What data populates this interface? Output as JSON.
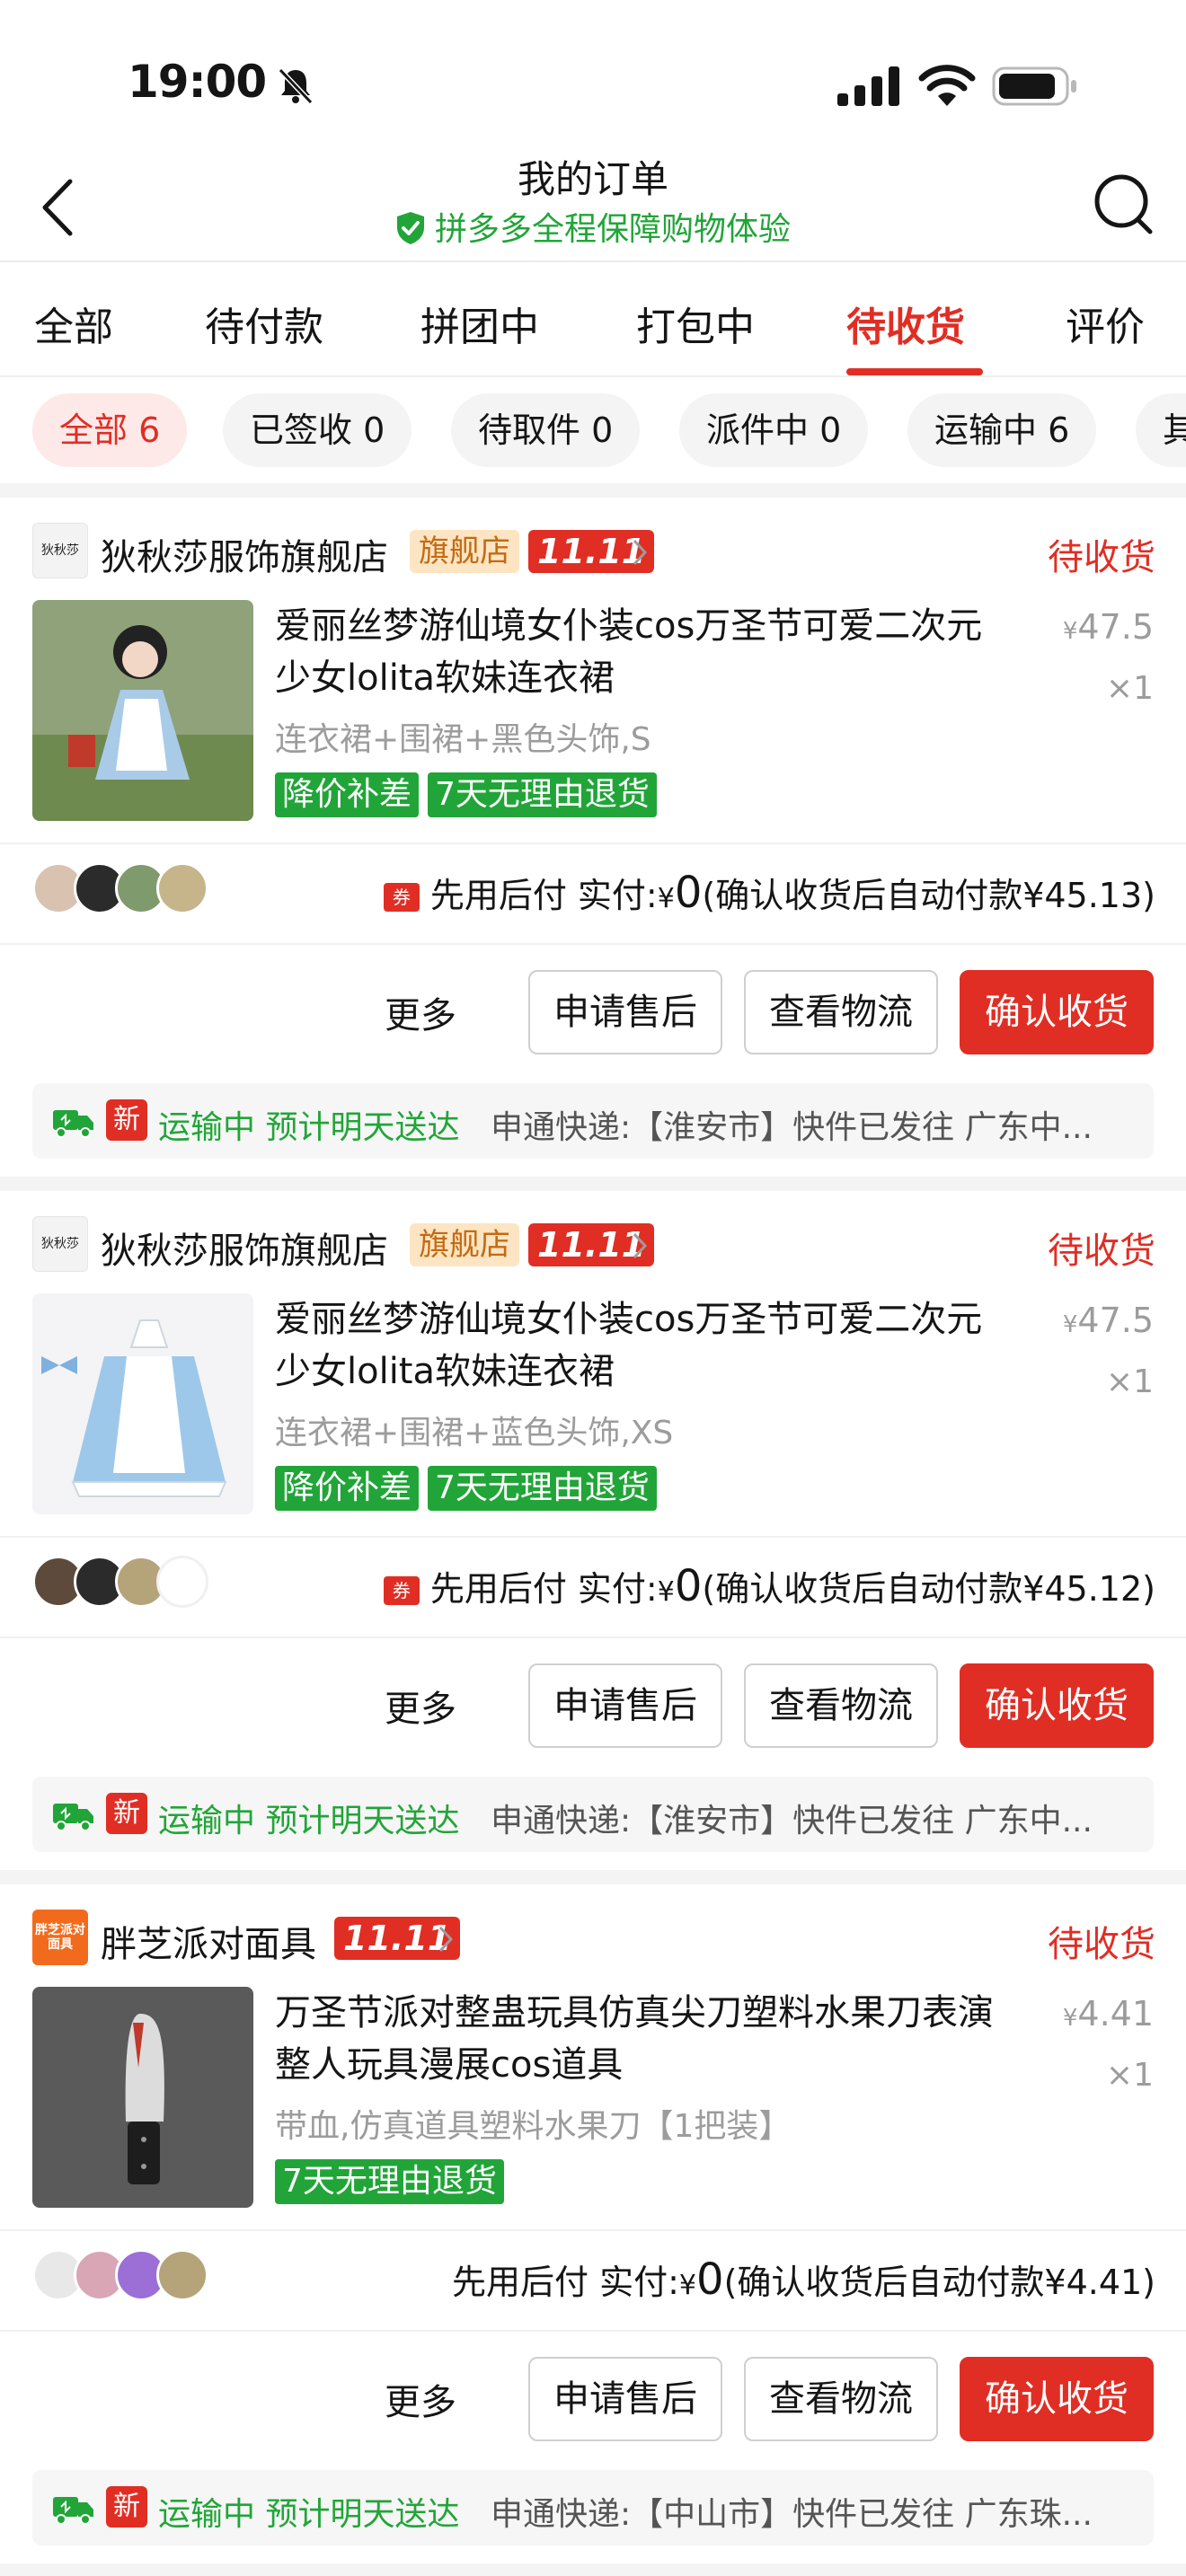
{
  "status_bar": {
    "time": "19:00"
  },
  "header": {
    "title": "我的订单",
    "subtitle": "拼多多全程保障购物体验"
  },
  "tabs": [
    {
      "label": "全部",
      "active": false
    },
    {
      "label": "待付款",
      "active": false
    },
    {
      "label": "拼团中",
      "active": false
    },
    {
      "label": "打包中",
      "active": false
    },
    {
      "label": "待收货",
      "active": true
    },
    {
      "label": "评价",
      "active": false
    }
  ],
  "filters": [
    {
      "label": "全部 6",
      "active": true
    },
    {
      "label": "已签收 0",
      "active": false
    },
    {
      "label": "待取件 0",
      "active": false
    },
    {
      "label": "派件中 0",
      "active": false
    },
    {
      "label": "运输中 6",
      "active": false
    },
    {
      "label": "其",
      "active": false
    }
  ],
  "colors": {
    "accent": "#e02e24",
    "green": "#21a538",
    "gray_text": "#9c9c9c"
  },
  "orders": [
    {
      "shop_logo_text": "狄秋莎",
      "shop_name": "狄秋莎服饰旗舰店",
      "flagship_badge": "旗舰店",
      "event_badge": "11.11",
      "status": "待收货",
      "title": "爱丽丝梦游仙境女仆装cos万圣节可爱二次元少女lolita软妹连衣裙",
      "spec": "连衣裙+围裙+黑色头饰,S",
      "tags": [
        "降价补差",
        "7天无理由退货"
      ],
      "price": "47.5",
      "qty": "×1",
      "pay_prefix": "先用后付 实付:",
      "pay_amount": "0",
      "pay_suffix": "(确认收货后自动付款¥45.13)",
      "coupon_icon": "券",
      "actions": {
        "more": "更多",
        "after_sale": "申请售后",
        "logistics": "查看物流",
        "confirm": "确认收货"
      },
      "log_new": "新",
      "log_status": "运输中 预计明天送达",
      "log_detail": "申通快递:【淮安市】快件已发往 广东中..."
    },
    {
      "shop_logo_text": "狄秋莎",
      "shop_name": "狄秋莎服饰旗舰店",
      "flagship_badge": "旗舰店",
      "event_badge": "11.11",
      "status": "待收货",
      "title": "爱丽丝梦游仙境女仆装cos万圣节可爱二次元少女lolita软妹连衣裙",
      "spec": "连衣裙+围裙+蓝色头饰,XS",
      "tags": [
        "降价补差",
        "7天无理由退货"
      ],
      "price": "47.5",
      "qty": "×1",
      "pay_prefix": "先用后付 实付:",
      "pay_amount": "0",
      "pay_suffix": "(确认收货后自动付款¥45.12)",
      "coupon_icon": "券",
      "actions": {
        "more": "更多",
        "after_sale": "申请售后",
        "logistics": "查看物流",
        "confirm": "确认收货"
      },
      "log_new": "新",
      "log_status": "运输中 预计明天送达",
      "log_detail": "申通快递:【淮安市】快件已发往 广东中..."
    },
    {
      "shop_logo_text": "胖芝派对面具",
      "shop_name": "胖芝派对面具",
      "flagship_badge": "",
      "event_badge": "11.11",
      "status": "待收货",
      "title": "万圣节派对整蛊玩具仿真尖刀塑料水果刀表演整人玩具漫展cos道具",
      "spec": "带血,仿真道具塑料水果刀【1把装】",
      "tags": [
        "7天无理由退货"
      ],
      "price": "4.41",
      "qty": "×1",
      "pay_prefix": "先用后付 实付:",
      "pay_amount": "0",
      "pay_suffix": "(确认收货后自动付款¥4.41)",
      "coupon_icon": "",
      "actions": {
        "more": "更多",
        "after_sale": "申请售后",
        "logistics": "查看物流",
        "confirm": "确认收货"
      },
      "log_new": "新",
      "log_status": "运输中 预计明天送达",
      "log_detail": "申通快递:【中山市】快件已发往 广东珠..."
    }
  ]
}
